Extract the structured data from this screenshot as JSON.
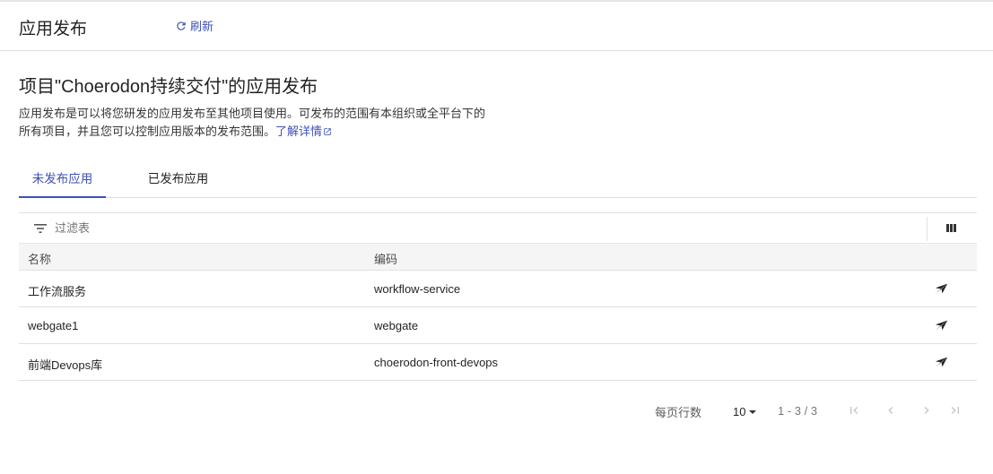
{
  "header": {
    "title": "应用发布",
    "refresh_label": "刷新"
  },
  "page": {
    "heading": "项目\"Choerodon持续交付\"的应用发布",
    "description": "应用发布是可以将您研发的应用发布至其他项目使用。可发布的范围有本组织或全平台下的所有项目，并且您可以控制应用版本的发布范围。",
    "learn_more": "了解详情"
  },
  "tabs": [
    {
      "label": "未发布应用",
      "active": true
    },
    {
      "label": "已发布应用",
      "active": false
    }
  ],
  "filter": {
    "placeholder": "过滤表"
  },
  "table": {
    "columns": [
      "名称",
      "编码"
    ],
    "rows": [
      {
        "name": "工作流服务",
        "code": "workflow-service"
      },
      {
        "name": "webgate1",
        "code": "webgate"
      },
      {
        "name": "前端Devops库",
        "code": "choerodon-front-devops"
      }
    ]
  },
  "pagination": {
    "rows_per_page_label": "每页行数",
    "page_size": "10",
    "range": "1 - 3 / 3"
  },
  "colors": {
    "accent": "#3f51b5",
    "header_bg": "#f5f5f5",
    "divider": "#e0e0e0"
  },
  "icons": {
    "refresh": "refresh-icon",
    "external_link": "external-link-icon",
    "filter": "filter-icon",
    "columns": "columns-icon",
    "publish": "send-icon",
    "first_page": "first-page-icon",
    "prev_page": "chevron-left-icon",
    "next_page": "chevron-right-icon",
    "last_page": "last-page-icon"
  }
}
